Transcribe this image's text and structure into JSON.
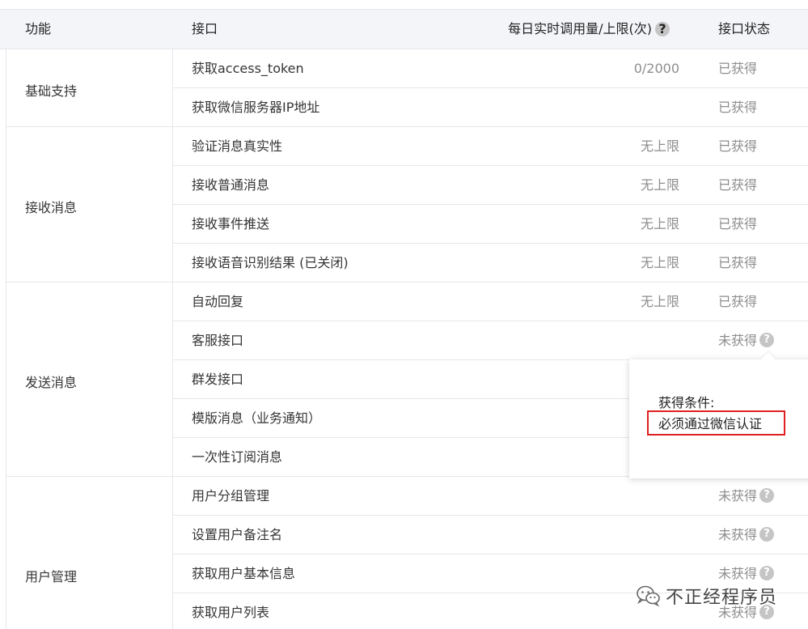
{
  "header": {
    "func": "功能",
    "api": "接口",
    "quota": "每日实时调用量/上限(次)",
    "status": "接口状态",
    "help_glyph": "?"
  },
  "groups": [
    {
      "label": "基础支持"
    },
    {
      "label": "接收消息"
    },
    {
      "label": "发送消息"
    },
    {
      "label": "用户管理"
    }
  ],
  "rows": [
    {
      "name": "获取access_token",
      "quota": "0/2000",
      "status": "已获得",
      "help": ""
    },
    {
      "name": "获取微信服务器IP地址",
      "quota": "",
      "status": "已获得",
      "help": ""
    },
    {
      "name": "验证消息真实性",
      "quota": "无上限",
      "status": "已获得",
      "help": ""
    },
    {
      "name": "接收普通消息",
      "quota": "无上限",
      "status": "已获得",
      "help": ""
    },
    {
      "name": "接收事件推送",
      "quota": "无上限",
      "status": "已获得",
      "help": ""
    },
    {
      "name": "接收语音识别结果 (已关闭)",
      "quota": "无上限",
      "status": "已获得",
      "help": ""
    },
    {
      "name": "自动回复",
      "quota": "无上限",
      "status": "已获得",
      "help": ""
    },
    {
      "name": "客服接口",
      "quota": "",
      "status": "未获得",
      "help": "?"
    },
    {
      "name": "群发接口",
      "quota": "",
      "status": "",
      "help": ""
    },
    {
      "name": "模版消息（业务通知）",
      "quota": "",
      "status": "",
      "help": ""
    },
    {
      "name": "一次性订阅消息",
      "quota": "",
      "status": "",
      "help": ""
    },
    {
      "name": "用户分组管理",
      "quota": "",
      "status": "未获得",
      "help": "?"
    },
    {
      "name": "设置用户备注名",
      "quota": "",
      "status": "未获得",
      "help": "?"
    },
    {
      "name": "获取用户基本信息",
      "quota": "",
      "status": "未获得",
      "help": "?"
    },
    {
      "name": "获取用户列表",
      "quota": "",
      "status": "未获得",
      "help": "?"
    }
  ],
  "popover": {
    "title": "获得条件:",
    "condition": "必须通过微信认证"
  },
  "watermark": {
    "text": "不正经程序员",
    "icon": "wechat-icon"
  },
  "colors": {
    "header_bg": "#f4f5f9",
    "border": "#e7e7eb",
    "muted_text": "#8d8d8d",
    "help_icon": "#c5c5c5",
    "highlight_box": "#e02020"
  }
}
